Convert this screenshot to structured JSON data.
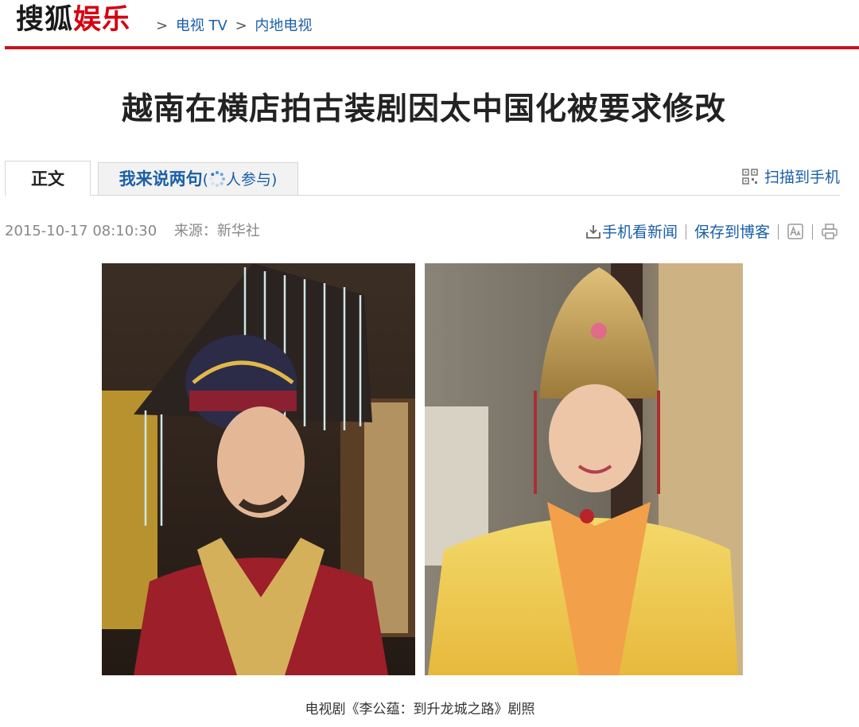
{
  "header": {
    "logo_part1": "搜狐",
    "logo_part2": "娱乐",
    "breadcrumb": {
      "sep1": ">",
      "item1": "电视 TV",
      "sep2": ">",
      "item2": "内地电视"
    }
  },
  "article": {
    "title": "越南在横店拍古装剧因太中国化被要求修改",
    "tabs": {
      "main": "正文",
      "comment_prefix": "我来说两句",
      "comment_open": "(",
      "comment_suffix": "人参与)"
    },
    "scan_label": "扫描到手机",
    "datetime": "2015-10-17 08:10:30",
    "source_label": "来源：新华社",
    "tools": {
      "mobile_news": "手机看新闻",
      "save_blog": "保存到博客"
    },
    "caption": "电视剧《李公蕴：到升龙城之路》剧照"
  },
  "colors": {
    "brand_red": "#c4161c",
    "link_blue": "#1a5fa8"
  },
  "icons": [
    "qr-scan-icon",
    "download-phone-icon",
    "font-size-icon",
    "print-icon",
    "loading-spinner-icon"
  ]
}
